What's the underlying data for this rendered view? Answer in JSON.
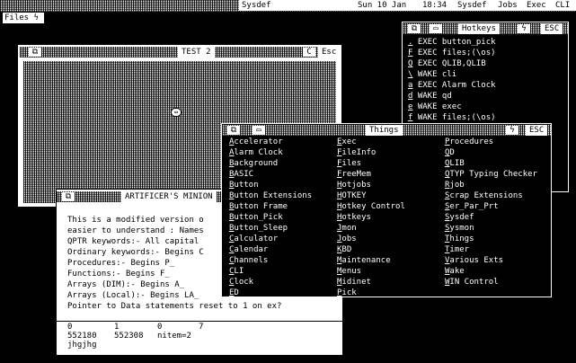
{
  "topbar": {
    "left_tab": "Files",
    "left_icon": "lightning-icon",
    "center": "Sysdef",
    "date": "Sun 10 Jan",
    "time": "18:34",
    "items": [
      "Sysdef",
      "Jobs",
      "Exec",
      "CLI"
    ]
  },
  "test2": {
    "title": "TEST 2",
    "esc": "Esc",
    "refresh_icon": "C"
  },
  "hotkeys": {
    "title": "Hotkeys",
    "esc": "ESC",
    "rows": [
      {
        "key": ".",
        "cmd": "EXEC button_pick"
      },
      {
        "key": "F",
        "cmd": "EXEC files;(\\os)"
      },
      {
        "key": "Q",
        "cmd": "EXEC QLIB,QLIB"
      },
      {
        "key": "\\",
        "cmd": "WAKE cli"
      },
      {
        "key": "a",
        "cmd": "EXEC Alarm Clock"
      },
      {
        "key": "d",
        "cmd": "WAKE qd"
      },
      {
        "key": "e",
        "cmd": "WAKE exec"
      },
      {
        "key": "f",
        "cmd": "WAKE files;(\\os)"
      }
    ]
  },
  "things": {
    "title": "Things",
    "esc": "ESC",
    "col1": [
      "Accelerator",
      "Alarm Clock",
      "Background",
      "BASIC",
      "Button",
      "Button Extensions",
      "Button Frame",
      "Button_Pick",
      "Button_Sleep",
      "Calculator",
      "Calendar",
      "Channels",
      "CLI",
      "Clock",
      "ED"
    ],
    "col2": [
      "Exec",
      "FileInfo",
      "Files",
      "FreeMem",
      "Hotjobs",
      "HOTKEY",
      "Hotkey Control",
      "Hotkeys",
      "Jmon",
      "Jobs",
      "KBD",
      "Maintenance",
      "Menus",
      "Midinet",
      "Pick"
    ],
    "col3": [
      "Procedures",
      "QD",
      "QLIB",
      "QTYP Typing Checker",
      "Rjob",
      "Scrap Extensions",
      "Ser_Par_Prt",
      "Sysdef",
      "Sysmon",
      "Things",
      "Timer",
      "Various Exts",
      "Wake",
      "WIN Control"
    ]
  },
  "artificer": {
    "title": "ARTIFICER'S MINION",
    "lines": [
      "This is a modified version o",
      "easier to understand : Names",
      "",
      "QPTR keywords:- All capital",
      "Ordinary keywords:- Begins C",
      "Procedures:- Begins P_",
      "Functions:- Begins F_",
      "Arrays (DIM):- Begins A_",
      "Arrays (Local):- Begins LA_",
      "",
      "Pointer to Data statements reset to 1 on ex?"
    ],
    "numrow1": [
      "0",
      "1",
      "0",
      "7"
    ],
    "numrow2": [
      "552180",
      "552308",
      "nitem=2"
    ],
    "input_line": "jhgjhg"
  }
}
